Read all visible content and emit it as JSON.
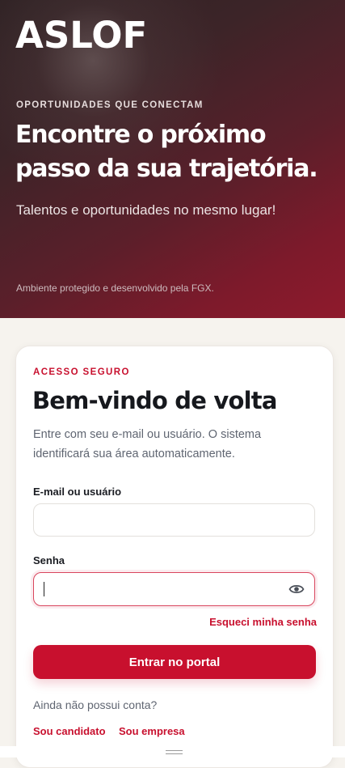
{
  "brand": {
    "logo_text": "ASLOF"
  },
  "hero": {
    "eyebrow": "OPORTUNIDADES QUE CONECTAM",
    "headline_line1": "Encontre o próximo",
    "headline_line2": "passo da sua trajetória.",
    "subtitle": "Talentos e oportunidades no mesmo lugar!",
    "footnote": "Ambiente protegido e desenvolvido pela FGX."
  },
  "login": {
    "eyebrow": "ACESSO SEGURO",
    "title": "Bem-vindo de volta",
    "description": "Entre com seu e-mail ou usuário. O sistema identificará sua área automaticamente.",
    "user_label": "E-mail ou usuário",
    "user_value": "",
    "password_label": "Senha",
    "password_value": "",
    "forgot_label": "Esqueci minha senha",
    "submit_label": "Entrar no portal",
    "no_account_text": "Ainda não possui conta?",
    "candidate_link": "Sou candidato",
    "company_link": "Sou empresa"
  },
  "colors": {
    "accent": "#c8102e",
    "hero_dark": "#2e2123",
    "hero_red": "#8f1a2c",
    "page_bg": "#f6f3ee"
  },
  "icons": {
    "toggle_password": "eye-icon"
  }
}
